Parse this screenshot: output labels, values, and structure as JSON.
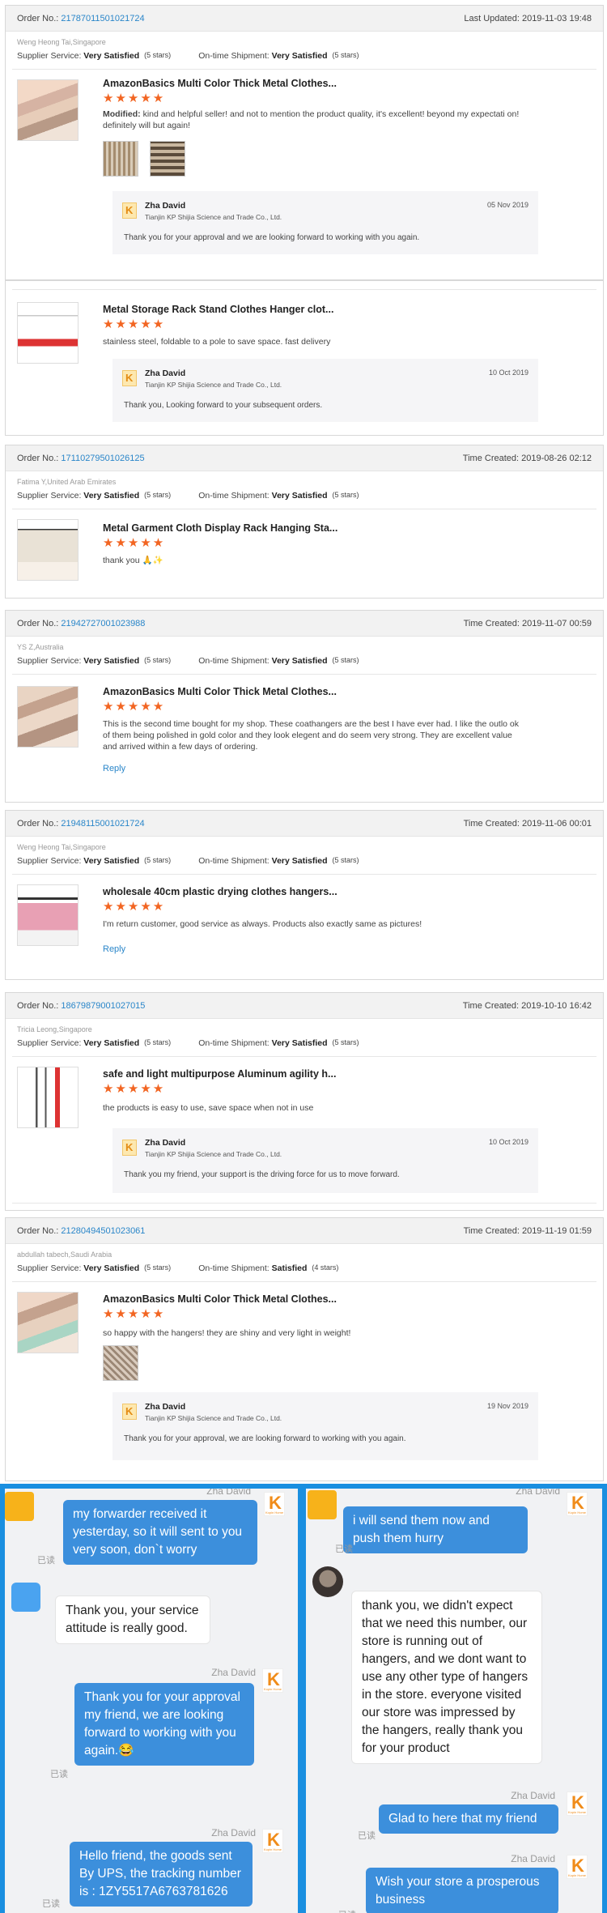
{
  "orders": [
    {
      "order_label": "Order No.:",
      "order_no": "21787011501021724",
      "time_label": "Last Updated:",
      "time": "2019-11-03 19:48",
      "buyer": "Weng Heong Tai,Singapore",
      "supplier_label": "Supplier Service:",
      "supplier_value": "Very Satisfied",
      "supplier_stars": "(5 stars)",
      "shipment_label": "On-time Shipment:",
      "shipment_value": "Very Satisfied",
      "shipment_stars": "(5 stars)",
      "items": [
        {
          "title": "AmazonBasics Multi Color Thick Metal Clothes...",
          "stars": "★★★★★",
          "text_bold": "Modified:",
          "text": "kind and helpful seller! and not to mention the product quality, it's excellent! beyond my expectati on! definitely will but again!",
          "reply": {
            "name": "Zha David",
            "company": "Tianjin KP Shijia Science and Trade Co., Ltd.",
            "date": "05 Nov 2019",
            "text": "Thank you for your approval and we are  looking forward to working with you again."
          }
        },
        {
          "title": "Metal Storage Rack Stand Clothes Hanger clot...",
          "stars": "★★★★★",
          "text": "stainless steel, foldable to a pole to save space. fast delivery",
          "reply": {
            "name": "Zha David",
            "company": "Tianjin KP Shijia Science and Trade Co., Ltd.",
            "date": "10 Oct 2019",
            "text": "Thank you, Looking forward to your subsequent orders."
          }
        }
      ]
    },
    {
      "order_label": "Order No.:",
      "order_no": "17110279501026125",
      "time_label": "Time Created:",
      "time": "2019-08-26 02:12",
      "buyer": "Fatima Y,United Arab Emirates",
      "supplier_label": "Supplier Service:",
      "supplier_value": "Very Satisfied",
      "supplier_stars": "(5 stars)",
      "shipment_label": "On-time Shipment:",
      "shipment_value": "Very Satisfied",
      "shipment_stars": "(5 stars)",
      "items": [
        {
          "title": "Metal Garment Cloth Display Rack Hanging Sta...",
          "stars": "★★★★★",
          "text": "thank you 🙏✨"
        }
      ]
    },
    {
      "order_label": "Order No.:",
      "order_no": "21942727001023988",
      "time_label": "Time Created:",
      "time": "2019-11-07 00:59",
      "buyer": "YS Z,Australia",
      "supplier_label": "Supplier Service:",
      "supplier_value": "Very Satisfied",
      "supplier_stars": "(5 stars)",
      "shipment_label": "On-time Shipment:",
      "shipment_value": "Very Satisfied",
      "shipment_stars": "(5 stars)",
      "items": [
        {
          "title": "AmazonBasics Multi Color Thick Metal Clothes...",
          "stars": "★★★★★",
          "text": "This is the second time bought for my shop. These coathangers are the best I have ever had. I like the outlo ok of them being polished in gold color and they look elegent and do seem very strong. They are excellent value and arrived within a few days of ordering.",
          "reply_link": "Reply"
        }
      ]
    },
    {
      "order_label": "Order No.:",
      "order_no": "21948115001021724",
      "time_label": "Time Created:",
      "time": "2019-11-06 00:01",
      "buyer": "Weng Heong Tai,Singapore",
      "supplier_label": "Supplier Service:",
      "supplier_value": "Very Satisfied",
      "supplier_stars": "(5 stars)",
      "shipment_label": "On-time Shipment:",
      "shipment_value": "Very Satisfied",
      "shipment_stars": "(5 stars)",
      "items": [
        {
          "title": "wholesale 40cm plastic drying clothes hangers...",
          "stars": "★★★★★",
          "text": "I'm return customer, good service as always. Products also exactly same as pictures!",
          "reply_link": "Reply"
        }
      ]
    },
    {
      "order_label": "Order No.:",
      "order_no": "18679879001027015",
      "time_label": "Time Created:",
      "time": "2019-10-10 16:42",
      "buyer": "Tricia Leong,Singapore",
      "supplier_label": "Supplier Service:",
      "supplier_value": "Very Satisfied",
      "supplier_stars": "(5 stars)",
      "shipment_label": "On-time Shipment:",
      "shipment_value": "Very Satisfied",
      "shipment_stars": "(5 stars)",
      "items": [
        {
          "title": "safe and light multipurpose Aluminum agility h...",
          "stars": "★★★★★",
          "text": "the products is easy to use, save space when not in use",
          "reply": {
            "name": "Zha David",
            "company": "Tianjin KP Shijia Science and Trade Co., Ltd.",
            "date": "10 Oct 2019",
            "text": "Thank you my friend, your support is the driving force for us to move forward."
          }
        }
      ]
    },
    {
      "order_label": "Order No.:",
      "order_no": "21280494501023061",
      "time_label": "Time Created:",
      "time": "2019-11-19 01:59",
      "buyer": "abdullah tabech,Saudi Arabia",
      "supplier_label": "Supplier Service:",
      "supplier_value": "Very Satisfied",
      "supplier_stars": "(5 stars)",
      "shipment_label": "On-time Shipment:",
      "shipment_value": "Satisfied",
      "shipment_stars": "(4 stars)",
      "items": [
        {
          "title": "AmazonBasics Multi Color Thick Metal Clothes...",
          "stars": "★★★★★",
          "text": "so happy with the hangers! they are shiny and very light in weight!",
          "reply": {
            "name": "Zha David",
            "company": "Tianjin KP Shijia Science and Trade Co., Ltd.",
            "date": "19 Nov 2019",
            "text": "Thank you for your approval, we are looking forward to working with you again."
          }
        }
      ]
    }
  ],
  "chat_left": {
    "top_name": "Zha David",
    "msg1": "my forwarder received it yesterday, so it will sent to you very soon, don`t worry",
    "read1": "已读",
    "msg2": "Thank you, your service attitude is really good.",
    "name2": "Zha David",
    "msg3": "Thank you for your approval my friend, we are looking forward to working with you again.😂",
    "read2": "已读",
    "name3": "Zha David",
    "msg4": "Hello friend, the goods sent By UPS, the tracking number is : 1ZY5517A6763781626",
    "read3": "已读"
  },
  "chat_right": {
    "top_name": "Zha David",
    "msg1": "i will send them now and push them hurry",
    "read1": "已读",
    "msg2": "thank you, we didn't expect that we need this number, our store is running out of hangers, and we dont want to use any other type of hangers in the store. everyone visited our store was impressed by the hangers, really thank you for your product",
    "name2": "Zha David",
    "msg3": "Glad to here that my friend",
    "read2": "已读",
    "name3": "Zha David",
    "msg4": "Wish your store a prosperous business",
    "read3": "已读"
  },
  "colors": {
    "accent": "#2a86c9",
    "stars": "#f26522",
    "chat_bubble": "#3c8fdc",
    "frame": "#1a8fe0"
  }
}
